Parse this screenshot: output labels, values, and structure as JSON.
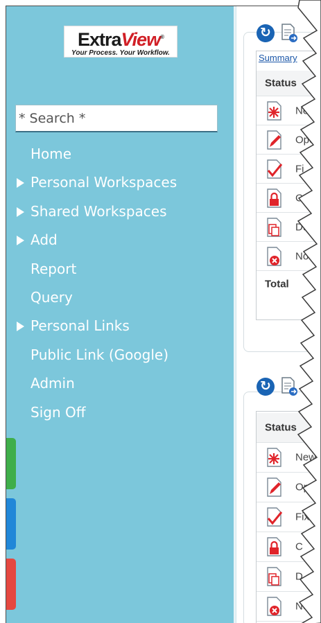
{
  "logo": {
    "name_part1": "Extra",
    "name_part2": "View",
    "trademark": "®",
    "tagline": "Your Process. Your Workflow."
  },
  "search": {
    "placeholder": "* Search *"
  },
  "nav": [
    {
      "label": "Home",
      "expandable": false
    },
    {
      "label": "Personal Workspaces",
      "expandable": true
    },
    {
      "label": "Shared Workspaces",
      "expandable": true
    },
    {
      "label": "Add",
      "expandable": true
    },
    {
      "label": "Report",
      "expandable": false
    },
    {
      "label": "Query",
      "expandable": false
    },
    {
      "label": "Personal Links",
      "expandable": true
    },
    {
      "label": "Public Link (Google)",
      "expandable": false
    },
    {
      "label": "Admin",
      "expandable": false
    },
    {
      "label": "Sign Off",
      "expandable": false
    }
  ],
  "colors": {
    "sidebar": "#7cc7db",
    "tab_green": "#3fae4a",
    "tab_blue": "#2187d8",
    "tab_red": "#e54840"
  },
  "panel1": {
    "summary_link": "Summary",
    "header": "Status",
    "rows": [
      {
        "label": "Ne",
        "icon": "new-status-icon"
      },
      {
        "label": "Open",
        "icon": "open-status-icon"
      },
      {
        "label": "Fi",
        "icon": "fixed-status-icon"
      },
      {
        "label": "C",
        "icon": "closed-status-icon"
      },
      {
        "label": "Dup",
        "icon": "duplicate-status-icon"
      },
      {
        "label": "Not",
        "icon": "not-a-problem-status-icon"
      }
    ],
    "total": "Total"
  },
  "panel2": {
    "header": "Status",
    "rows": [
      {
        "label": "New",
        "icon": "new-status-icon"
      },
      {
        "label": "Op",
        "icon": "open-status-icon"
      },
      {
        "label": "Fix",
        "icon": "fixed-status-icon"
      },
      {
        "label": "C",
        "icon": "closed-status-icon"
      },
      {
        "label": "D",
        "icon": "duplicate-status-icon"
      },
      {
        "label": "No",
        "icon": "not-a-problem-status-icon"
      }
    ]
  }
}
